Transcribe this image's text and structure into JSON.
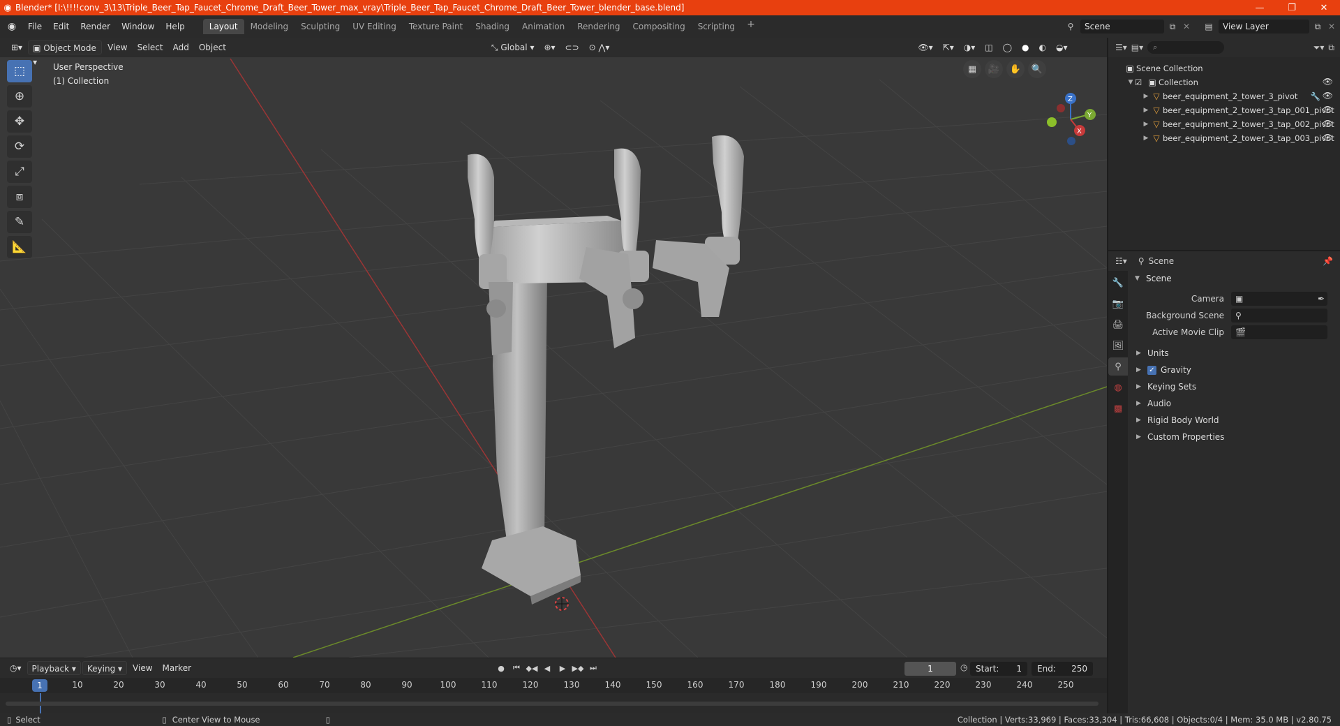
{
  "titlebar": {
    "title": "Blender* [I:\\!!!!conv_3\\13\\Triple_Beer_Tap_Faucet_Chrome_Draft_Beer_Tower_max_vray\\Triple_Beer_Tap_Faucet_Chrome_Draft_Beer_Tower_blender_base.blend]",
    "minimize": "—",
    "maximize": "❐",
    "close": "✕"
  },
  "menu": [
    "File",
    "Edit",
    "Render",
    "Window",
    "Help"
  ],
  "workspaces": [
    "Layout",
    "Modeling",
    "Sculpting",
    "UV Editing",
    "Texture Paint",
    "Shading",
    "Animation",
    "Rendering",
    "Compositing",
    "Scripting"
  ],
  "active_workspace": "Layout",
  "scene_name": "Scene",
  "view_layer_name": "View Layer",
  "viewport": {
    "mode": "Object Mode",
    "menus": [
      "View",
      "Select",
      "Add",
      "Object"
    ],
    "transform_orientation": "Global",
    "perspective_label": "User Perspective",
    "collection_label": "(1) Collection",
    "gizmo": {
      "x": "X",
      "y": "Y",
      "z": "Z"
    }
  },
  "timeline": {
    "menus": [
      "Playback",
      "Keying",
      "View",
      "Marker"
    ],
    "current_frame": "1",
    "start_label": "Start:",
    "start": "1",
    "end_label": "End:",
    "end": "250",
    "ticks": [
      "10",
      "20",
      "30",
      "40",
      "50",
      "60",
      "70",
      "80",
      "90",
      "100",
      "110",
      "120",
      "130",
      "140",
      "150",
      "160",
      "170",
      "180",
      "190",
      "200",
      "210",
      "220",
      "230",
      "240",
      "250"
    ],
    "playhead": "1"
  },
  "statusbar": {
    "select": "Select",
    "center_view": "Center View to Mouse",
    "stats": "Collection | Verts:33,969 | Faces:33,304 | Tris:66,608 | Objects:0/4 | Mem: 35.0 MB | v2.80.75"
  },
  "outliner": {
    "root": "Scene Collection",
    "collection": "Collection",
    "items": [
      "beer_equipment_2_tower_3_pivot",
      "beer_equipment_2_tower_3_tap_001_pivot",
      "beer_equipment_2_tower_3_tap_002_pivot",
      "beer_equipment_2_tower_3_tap_003_pivot"
    ]
  },
  "properties": {
    "context": "Scene",
    "panel": "Scene",
    "fields": [
      {
        "label": "Camera",
        "value": ""
      },
      {
        "label": "Background Scene",
        "value": ""
      },
      {
        "label": "Active Movie Clip",
        "value": ""
      }
    ],
    "subpanels": [
      "Units",
      "Gravity",
      "Keying Sets",
      "Audio",
      "Rigid Body World",
      "Custom Properties"
    ]
  }
}
